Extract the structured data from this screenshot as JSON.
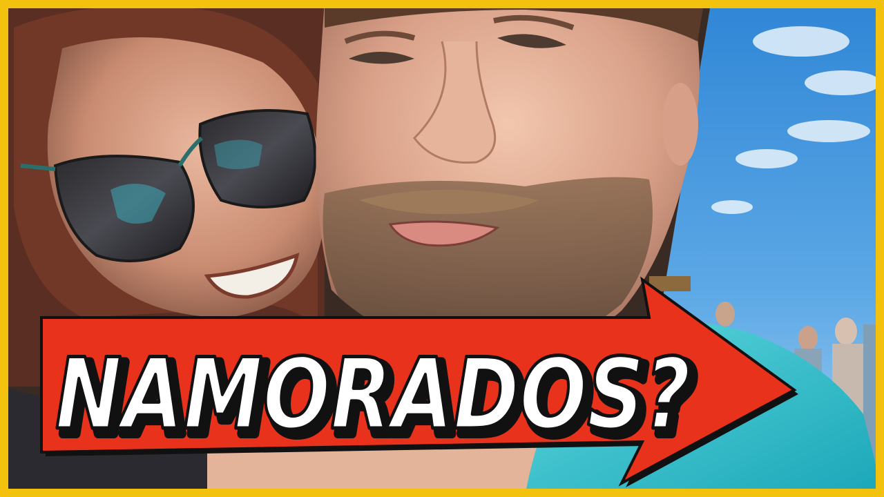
{
  "thumbnail": {
    "caption": "NAMORADOS?",
    "colors": {
      "frame": "#f2c20f",
      "arrow": "#e8321c",
      "arrow_outline": "#111111",
      "caption_fill": "#ffffff",
      "sky": "#3f95de",
      "sweater": "#2fc3cf"
    }
  }
}
